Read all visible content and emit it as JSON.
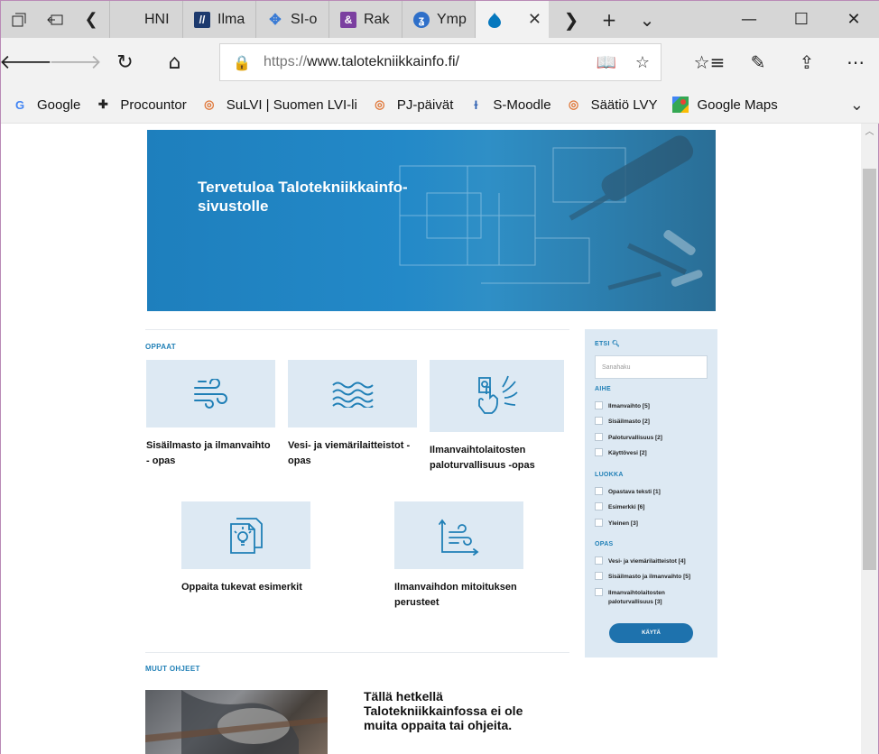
{
  "browser": {
    "tabs": [
      {
        "title": "HNI",
        "icon": "hni-favicon",
        "color": "#6b8fb5"
      },
      {
        "title": "Ilma",
        "icon": "ilma-favicon",
        "color": "#1d3a6e"
      },
      {
        "title": "SI-o",
        "icon": "si-favicon",
        "color": "#3a7bd5"
      },
      {
        "title": "Rak",
        "icon": "rak-favicon",
        "color": "#7b3fa0"
      },
      {
        "title": "Ymp",
        "icon": "ymp-favicon",
        "color": "#2e6fc9"
      },
      {
        "title": "",
        "icon": "drupal-favicon",
        "color": "#0678be",
        "active": true
      }
    ],
    "address": {
      "scheme": "https://",
      "host": "www.talotekniikkainfo.fi/"
    },
    "favorites": [
      {
        "label": "Google",
        "icon": "google-icon"
      },
      {
        "label": "Procountor",
        "icon": "procountor-icon"
      },
      {
        "label": "SuLVI | Suomen LVI-li",
        "icon": "sulvi-icon"
      },
      {
        "label": "PJ-päivät",
        "icon": "pj-icon"
      },
      {
        "label": "S-Moodle",
        "icon": "moodle-icon"
      },
      {
        "label": "Säätiö LVY",
        "icon": "lvy-icon"
      },
      {
        "label": "Google Maps",
        "icon": "maps-icon"
      }
    ]
  },
  "hero": {
    "title": "Tervetuloa Talotekniikkainfo-sivustolle"
  },
  "guides": {
    "label": "OPPAAT",
    "items": [
      {
        "caption": "Sisäilmasto ja ilmanvaihto - opas",
        "icon": "wind-icon"
      },
      {
        "caption": "Vesi- ja viemärilaitteistot - opas",
        "icon": "water-waves-icon"
      },
      {
        "caption": "Ilmanvaihtolaitosten paloturvallisuus -opas",
        "icon": "fire-alarm-hand-icon"
      },
      {
        "caption": "Oppaita tukevat esimerkit",
        "icon": "documents-lightbulb-icon"
      },
      {
        "caption": "Ilmanvaihdon mitoituksen perusteet",
        "icon": "airflow-chart-icon"
      }
    ]
  },
  "other": {
    "label": "MUUT OHJEET",
    "text": "Tällä hetkellä Talotekniikkainfossa ei ole muita oppaita tai ohjeita."
  },
  "sidebar": {
    "search_label": "ETSI",
    "search_placeholder": "Sanahaku",
    "groups": [
      {
        "title": "AIHE",
        "options": [
          "Ilmanvaihto [5]",
          "Sisäilmasto [2]",
          "Paloturvallisuus [2]",
          "Käyttövesi [2]"
        ]
      },
      {
        "title": "LUOKKA",
        "options": [
          "Opastava teksti [1]",
          "Esimerkki [6]",
          "Yleinen [3]"
        ]
      },
      {
        "title": "OPAS",
        "options": [
          "Vesi- ja viemärilaitteistot [4]",
          "Sisäilmasto ja ilmanvaihto [5]",
          "Ilmanvaihtolaitosten paloturvallisuus [3]"
        ]
      }
    ],
    "apply_label": "KÄYTÄ"
  }
}
